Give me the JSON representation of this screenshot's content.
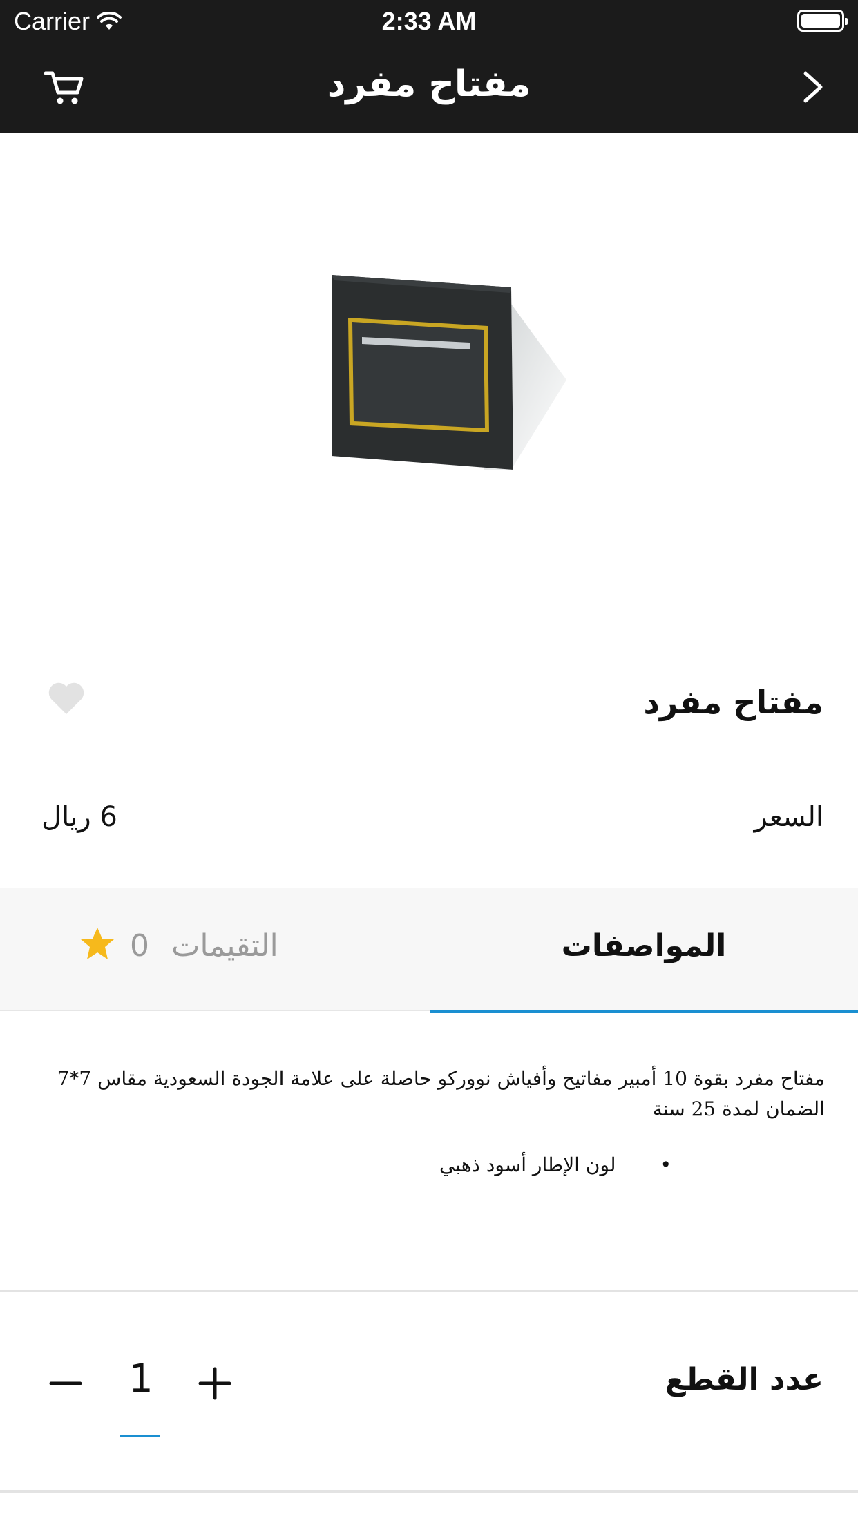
{
  "status_bar": {
    "carrier": "Carrier",
    "time": "2:33 AM"
  },
  "header": {
    "title": "مفتاح مفرد",
    "cart_icon": "cart-icon",
    "back_icon": "chevron-right-icon"
  },
  "product": {
    "name": "مفتاح مفرد",
    "price_label": "السعر",
    "price_value": "6 ريال",
    "image": "black-light-switch-gold-frame"
  },
  "tabs": {
    "specs_label": "المواصفات",
    "reviews_label": "التقيمات",
    "reviews_count": "0"
  },
  "description": {
    "text": "مفتاح مفرد بقوة 10 أمبير مفاتيح وأفياش نووركو حاصلة على علامة الجودة السعودية مقاس 7*7 الضمان لمدة 25 سنة",
    "bullet_mark": "•",
    "bullet": "لون الإطار أسود ذهبي"
  },
  "quantity": {
    "label": "عدد القطع",
    "value": "1"
  },
  "colors": {
    "header_bg": "#1b1b1b",
    "accent": "#1a8fd1",
    "star": "#f6b91c",
    "tab_bg": "#f7f7f7"
  }
}
